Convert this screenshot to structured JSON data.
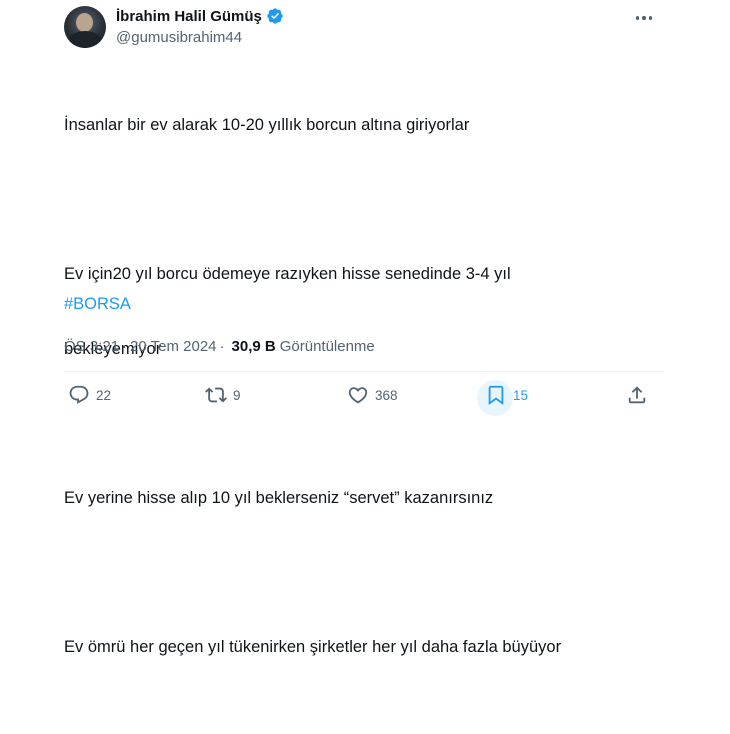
{
  "author": {
    "name": "İbrahim Halil Gümüş",
    "handle": "@gumusibrahim44",
    "verified": true,
    "verified_color": "#1d9bf0"
  },
  "tweet": {
    "paragraphs": [
      [
        "İnsanlar bir ev alarak 10-20 yıllık borcun altına giriyorlar"
      ],
      [
        "Ev için20 yıl borcu ödemeye razıyken hisse senedinde 3-4 yıl",
        "bekleyemiyor"
      ],
      [
        "Ev yerine hisse alıp 10 yıl beklerseniz “servet” kazanırsınız"
      ],
      [
        "Ev ömrü her geçen yıl tükenirken şirketler her yıl daha fazla büyüyor"
      ]
    ],
    "hashtag": "#BORSA",
    "hashtag_color": "#1d9bf0"
  },
  "meta": {
    "time": "ÖS 3:21",
    "separator": "·",
    "date": "20 Tem 2024",
    "views_count": "30,9 B",
    "views_label": "Görüntülenme"
  },
  "actions": {
    "replies": "22",
    "retweets": "9",
    "likes": "368",
    "bookmarks": "15",
    "bookmarked": true,
    "accent_color": "#1d9bf0",
    "icon_color": "#536471"
  },
  "icons": [
    "verified-badge-icon",
    "more-options-icon",
    "reply-icon",
    "retweet-icon",
    "like-icon",
    "bookmark-icon",
    "share-icon"
  ]
}
